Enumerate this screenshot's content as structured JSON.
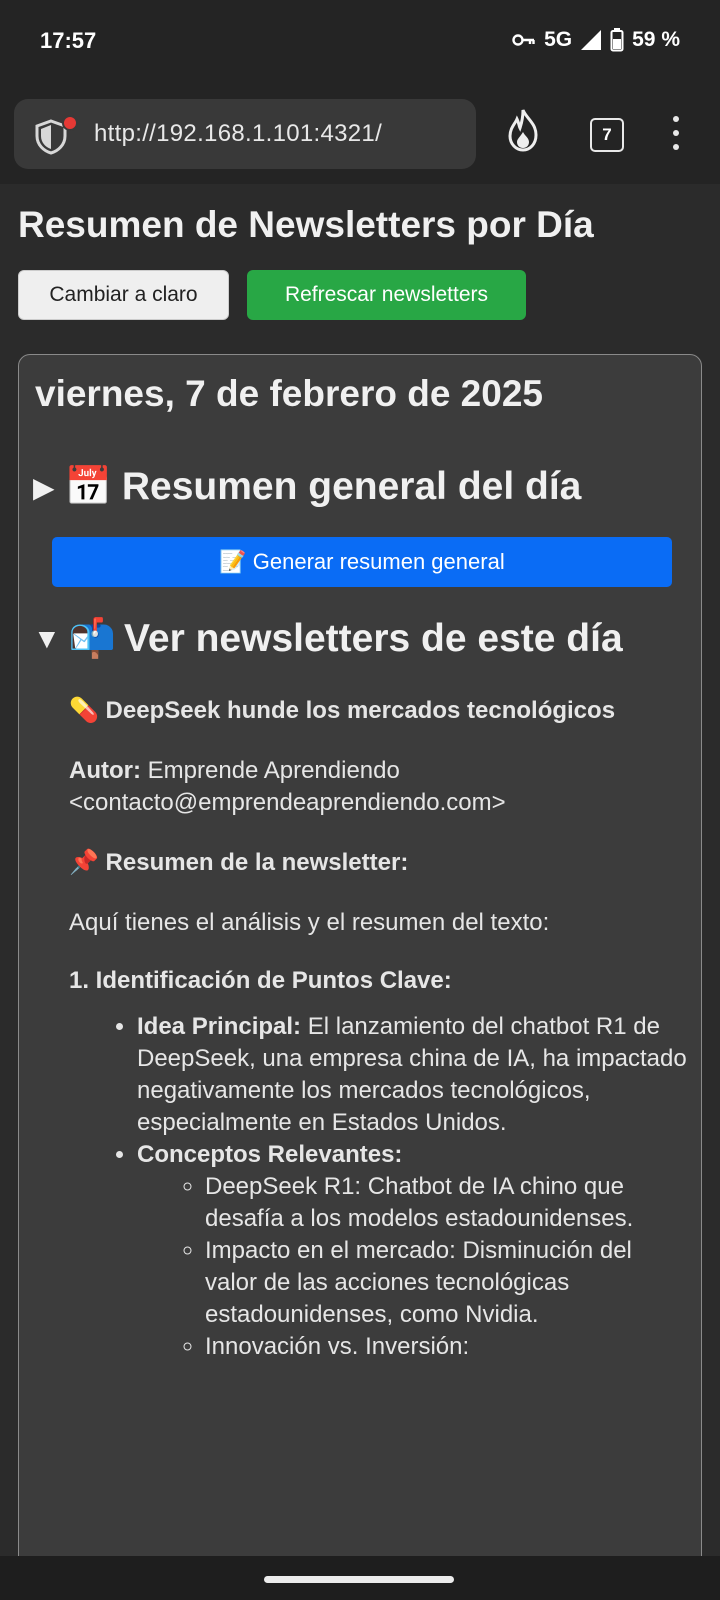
{
  "status": {
    "time": "17:57",
    "network": "5G",
    "battery": "59 %"
  },
  "browser": {
    "url": "http://192.168.1.101:4321/",
    "tab_count": "7"
  },
  "page": {
    "title": "Resumen de Newsletters por Día",
    "theme_button": "Cambiar a claro",
    "refresh_button": "Refrescar newsletters"
  },
  "day": {
    "date": "viernes, 7 de febrero de 2025",
    "summary_toggle": {
      "arrow": "▶",
      "emoji": "📅",
      "label": "Resumen general del día"
    },
    "generate_button": "📝 Generar resumen general",
    "newsletters_toggle": {
      "arrow": "▼",
      "emoji": "📬",
      "label": "Ver newsletters de este día"
    },
    "newsletter": {
      "title": "💊 DeepSeek hunde los mercados tecnológicos",
      "author_label": "Autor:",
      "author_value": " Emprende Aprendiendo <contacto@emprendeaprendiendo.com>",
      "summary_label": "📌 Resumen de la newsletter:",
      "intro": "Aquí tienes el análisis y el resumen del texto:",
      "section": "1. Identificación de Puntos Clave:",
      "points": [
        {
          "label": "Idea Principal:",
          "text": " El lanzamiento del chatbot R1 de DeepSeek, una empresa china de IA, ha impactado negativamente los mercados tecnológicos, especialmente en Estados Unidos."
        },
        {
          "label": "Conceptos Relevantes:",
          "text": ""
        }
      ],
      "sub_points": [
        "DeepSeek R1: Chatbot de IA chino que desafía a los modelos estadounidenses.",
        "Impacto en el mercado: Disminución del valor de las acciones tecnológicas estadounidenses, como Nvidia.",
        "Innovación vs. Inversión:"
      ]
    }
  }
}
